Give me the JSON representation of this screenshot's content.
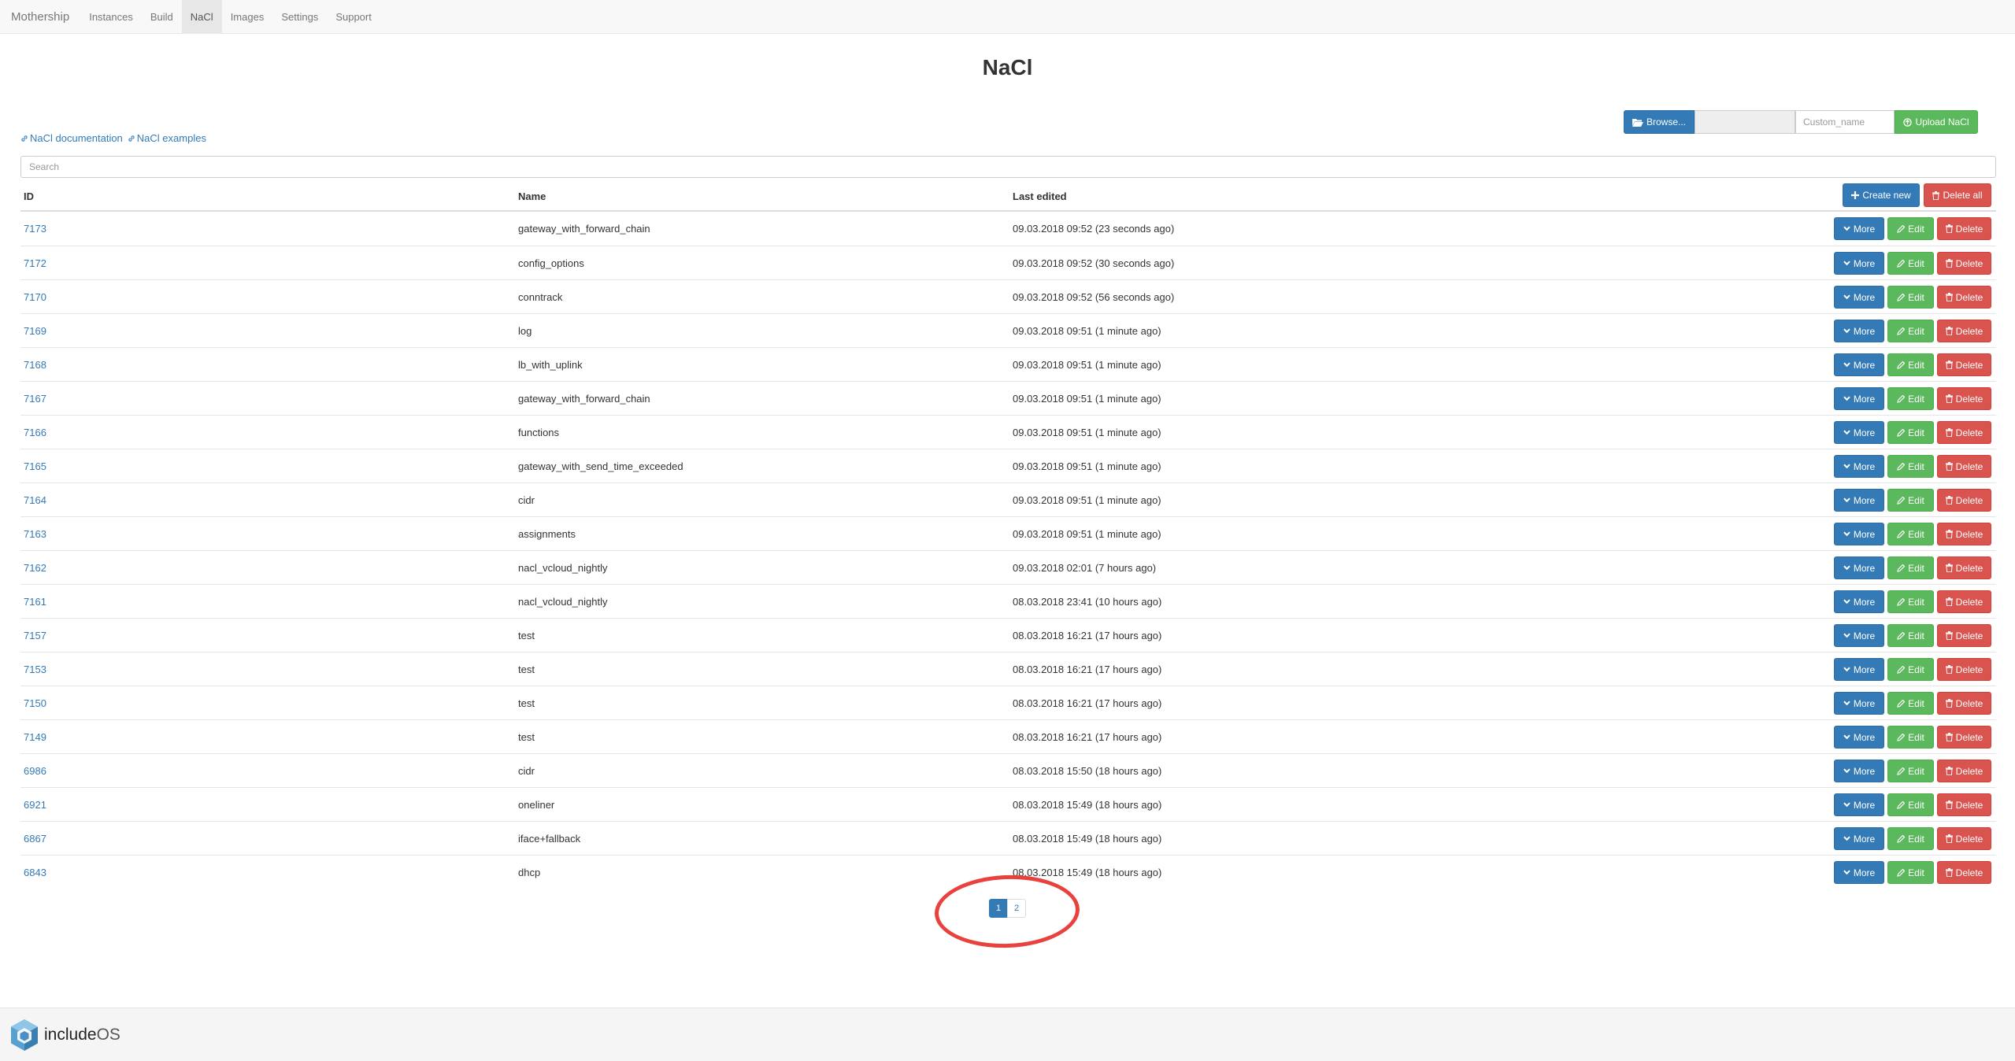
{
  "navbar": {
    "brand": "Mothership",
    "items": [
      {
        "label": "Instances",
        "active": false
      },
      {
        "label": "Build",
        "active": false
      },
      {
        "label": "NaCl",
        "active": true
      },
      {
        "label": "Images",
        "active": false
      },
      {
        "label": "Settings",
        "active": false
      },
      {
        "label": "Support",
        "active": false
      }
    ]
  },
  "page": {
    "title": "NaCl"
  },
  "upload": {
    "browse_label": "Browse...",
    "file_value": "",
    "custom_name_placeholder": "Custom_name",
    "upload_label": "Upload NaCl",
    "colors": {
      "primary": "#337ab7",
      "success": "#5cb85c",
      "danger": "#d9534f"
    }
  },
  "links": [
    {
      "label": "NaCl documentation",
      "icon": "link-icon"
    },
    {
      "label": "NaCl examples",
      "icon": "link-icon"
    }
  ],
  "search": {
    "placeholder": "Search",
    "value": ""
  },
  "table": {
    "columns": {
      "id": "ID",
      "name": "Name",
      "last_edited": "Last edited"
    },
    "create_label": "Create new",
    "delete_all_label": "Delete all",
    "action_labels": {
      "more": "More",
      "edit": "Edit",
      "delete": "Delete"
    },
    "rows": [
      {
        "id": "7173",
        "name": "gateway_with_forward_chain",
        "last_edited": "09.03.2018 09:52 (23 seconds ago)"
      },
      {
        "id": "7172",
        "name": "config_options",
        "last_edited": "09.03.2018 09:52 (30 seconds ago)"
      },
      {
        "id": "7170",
        "name": "conntrack",
        "last_edited": "09.03.2018 09:52 (56 seconds ago)"
      },
      {
        "id": "7169",
        "name": "log",
        "last_edited": "09.03.2018 09:51 (1 minute ago)"
      },
      {
        "id": "7168",
        "name": "lb_with_uplink",
        "last_edited": "09.03.2018 09:51 (1 minute ago)"
      },
      {
        "id": "7167",
        "name": "gateway_with_forward_chain",
        "last_edited": "09.03.2018 09:51 (1 minute ago)"
      },
      {
        "id": "7166",
        "name": "functions",
        "last_edited": "09.03.2018 09:51 (1 minute ago)"
      },
      {
        "id": "7165",
        "name": "gateway_with_send_time_exceeded",
        "last_edited": "09.03.2018 09:51 (1 minute ago)"
      },
      {
        "id": "7164",
        "name": "cidr",
        "last_edited": "09.03.2018 09:51 (1 minute ago)"
      },
      {
        "id": "7163",
        "name": "assignments",
        "last_edited": "09.03.2018 09:51 (1 minute ago)"
      },
      {
        "id": "7162",
        "name": "nacl_vcloud_nightly",
        "last_edited": "09.03.2018 02:01 (7 hours ago)"
      },
      {
        "id": "7161",
        "name": "nacl_vcloud_nightly",
        "last_edited": "08.03.2018 23:41 (10 hours ago)"
      },
      {
        "id": "7157",
        "name": "test",
        "last_edited": "08.03.2018 16:21 (17 hours ago)"
      },
      {
        "id": "7153",
        "name": "test",
        "last_edited": "08.03.2018 16:21 (17 hours ago)"
      },
      {
        "id": "7150",
        "name": "test",
        "last_edited": "08.03.2018 16:21 (17 hours ago)"
      },
      {
        "id": "7149",
        "name": "test",
        "last_edited": "08.03.2018 16:21 (17 hours ago)"
      },
      {
        "id": "6986",
        "name": "cidr",
        "last_edited": "08.03.2018 15:50 (18 hours ago)"
      },
      {
        "id": "6921",
        "name": "oneliner",
        "last_edited": "08.03.2018 15:49 (18 hours ago)"
      },
      {
        "id": "6867",
        "name": "iface+fallback",
        "last_edited": "08.03.2018 15:49 (18 hours ago)"
      },
      {
        "id": "6843",
        "name": "dhcp",
        "last_edited": "08.03.2018 15:49 (18 hours ago)"
      }
    ]
  },
  "pagination": {
    "pages": [
      "1",
      "2"
    ],
    "current": "1"
  },
  "annotation": {
    "shape": "ellipse",
    "color": "#e8413e"
  },
  "footer": {
    "logo_text_bold": "include",
    "logo_text_light": "OS"
  }
}
